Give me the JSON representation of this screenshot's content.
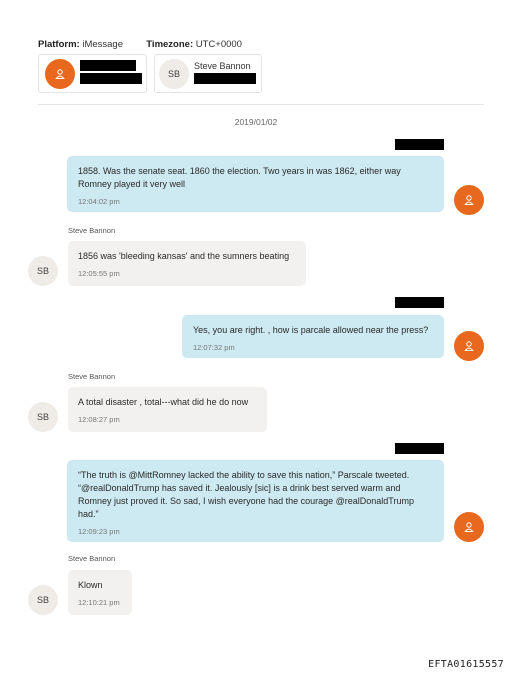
{
  "header": {
    "platform_label": "Platform:",
    "platform_value": "iMessage",
    "timezone_label": "Timezone:",
    "timezone_value": "UTC+0000"
  },
  "participants": [
    {
      "initials": "",
      "name": "[redacted]",
      "redacted": true
    },
    {
      "initials": "SB",
      "name": "Steve Bannon",
      "redacted_line": true
    }
  ],
  "date_divider": "2019/01/02",
  "messages": [
    {
      "direction": "outgoing",
      "sender": "",
      "text": "1858. Was the senate seat. 1860 the election.  Two years in was 1862,     either way Romney played it very well",
      "time": "12:04:02 pm"
    },
    {
      "direction": "incoming",
      "sender": "Steve Bannon",
      "initials": "SB",
      "text": "1856 was 'bleeding kansas' and the sumners beating",
      "time": "12:05:55 pm"
    },
    {
      "direction": "outgoing",
      "sender": "",
      "text": "Yes, you are right.  ,  how is parcale allowed near the press?",
      "time": "12:07:32 pm"
    },
    {
      "direction": "incoming",
      "sender": "Steve Bannon",
      "initials": "SB",
      "text": "A total disaster , total---what did he do now",
      "time": "12:08:27 pm"
    },
    {
      "direction": "outgoing",
      "sender": "",
      "text": "“The truth is @MittRomney lacked the ability to save this nation,” Parscale tweeted. “@realDonaldTrump has saved it. Jealously [sic] is a drink best served warm and Romney just proved it. So sad, I wish everyone had the courage @realDonaldTrump had.”",
      "time": "12:09:23 pm"
    },
    {
      "direction": "incoming",
      "sender": "Steve Bannon",
      "initials": "SB",
      "text": "Klown",
      "time": "12:10:21 pm"
    }
  ],
  "footer": {
    "doc_id": "EFTA01615557"
  },
  "colors": {
    "outgoing_bubble": "#cde9f1",
    "incoming_bubble": "#f3f1ef",
    "user_avatar": "#e8691e",
    "sb_avatar": "#efebe6"
  },
  "icons": {
    "user_avatar": "person-icon"
  }
}
